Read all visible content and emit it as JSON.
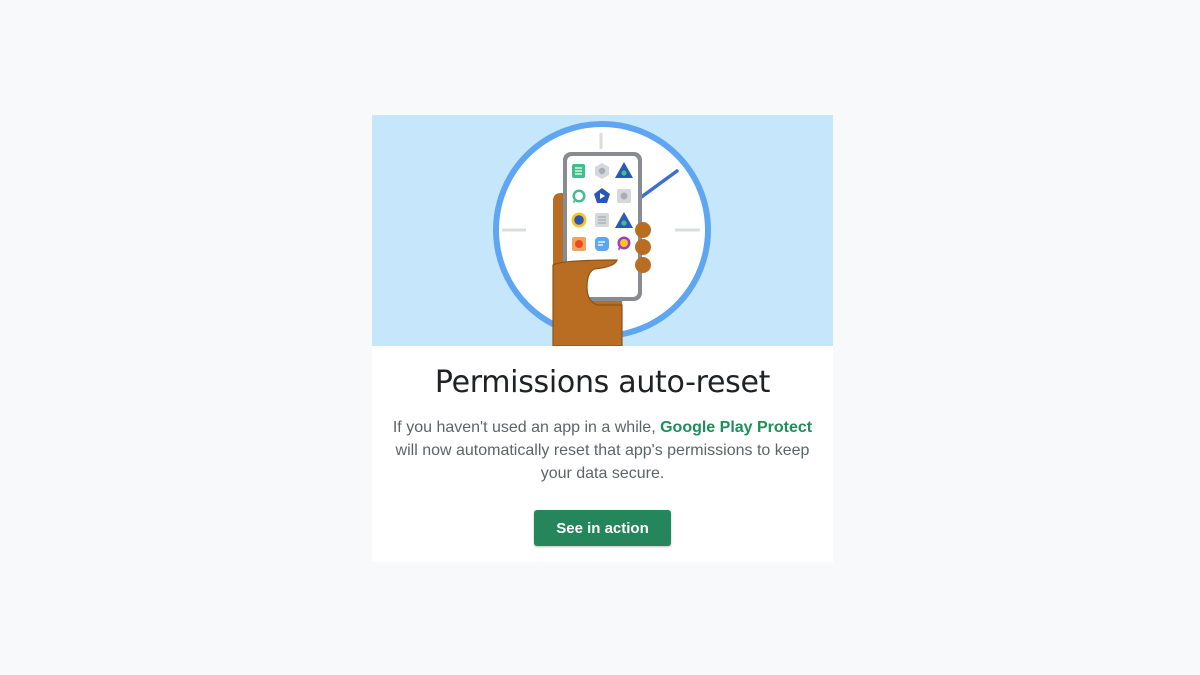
{
  "card": {
    "illustration": {
      "name": "hand-holding-phone-with-app-grid-clock-icon",
      "colors": {
        "background": "#c6e6fb",
        "ring": "#5ea6f2",
        "clock_hand": "#3b6fd0",
        "skin": "#b86d22",
        "phone_frame": "#888c92"
      },
      "app_icons": [
        "document-icon",
        "hexagon-icon",
        "triangle-icon",
        "chat-bubble-icon",
        "pentagon-play-icon",
        "square-icon",
        "circle-icon",
        "list-icon",
        "triangle-icon",
        "square-dot-icon",
        "message-icon",
        "chat-bubble-icon"
      ]
    },
    "title": "Permissions auto-reset",
    "body_prefix": "If you haven't used an app in a while, ",
    "body_link": "Google Play Protect",
    "body_suffix": " will now automatically reset that app's permissions to keep your data secure.",
    "button_label": "See in action",
    "colors": {
      "link": "#1e8e5a",
      "button": "#25855b",
      "page_bg": "#f8f9fa"
    }
  }
}
